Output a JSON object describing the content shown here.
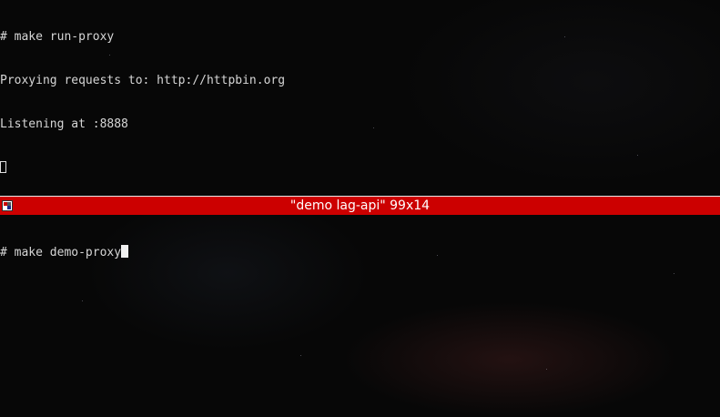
{
  "top_pane": {
    "lines": [
      "# make run-proxy",
      "Proxying requests to: http://httpbin.org",
      "Listening at :8888"
    ]
  },
  "divider": {
    "title": "\"demo lag-api\" 99x14",
    "icon": "terminal-window-icon",
    "color": "#cc0000"
  },
  "bottom_pane": {
    "prompt": "# make demo-proxy"
  }
}
